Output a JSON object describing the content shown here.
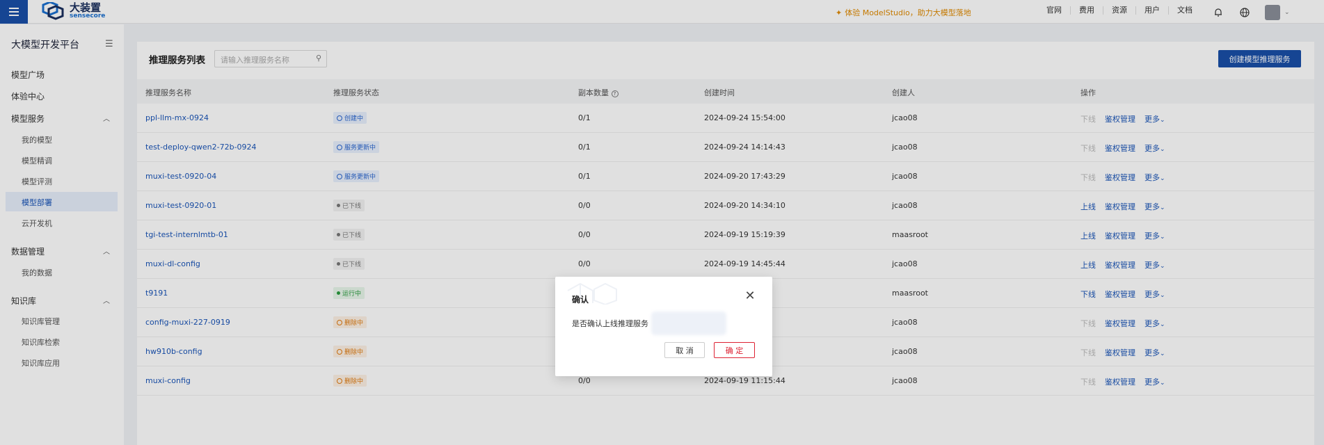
{
  "topbar": {
    "logo_cn": "大装置",
    "logo_en": "sensecore",
    "promo": "体验 ModelStudio，助力大模型落地",
    "links": [
      "官网",
      "费用",
      "资源",
      "用户",
      "文档"
    ]
  },
  "sidebar": {
    "title": "大模型开发平台",
    "items": {
      "model_square": "模型广场",
      "experience": "体验中心",
      "model_service": "模型服务",
      "my_models": "我的模型",
      "finetune": "模型精调",
      "evaluate": "模型评测",
      "deploy": "模型部署",
      "dev_machine": "云开发机",
      "data_mgmt": "数据管理",
      "my_data": "我的数据",
      "knowledge": "知识库",
      "kb_mgmt": "知识库管理",
      "kb_search": "知识库检索",
      "kb_app": "知识库应用"
    }
  },
  "main": {
    "list_title": "推理服务列表",
    "search_placeholder": "请输入推理服务名称",
    "create_button": "创建模型推理服务",
    "columns": [
      "推理服务名称",
      "推理服务状态",
      "副本数量",
      "创建时间",
      "创建人",
      "操作"
    ],
    "action_labels": {
      "offline": "下线",
      "online": "上线",
      "auth": "鉴权管理",
      "more": "更多"
    },
    "rows": [
      {
        "name": "ppl-llm-mx-0924",
        "status": "创建中",
        "status_color": "blue",
        "replicas": "0/1",
        "created": "2024-09-24 15:54:00",
        "creator": "jcao08",
        "toggle": "下线",
        "toggle_enabled": false
      },
      {
        "name": "test-deploy-qwen2-72b-0924",
        "status": "服务更新中",
        "status_color": "blue",
        "replicas": "0/1",
        "created": "2024-09-24 14:14:43",
        "creator": "jcao08",
        "toggle": "下线",
        "toggle_enabled": false
      },
      {
        "name": "muxi-test-0920-04",
        "status": "服务更新中",
        "status_color": "blue",
        "replicas": "0/1",
        "created": "2024-09-20 17:43:29",
        "creator": "jcao08",
        "toggle": "下线",
        "toggle_enabled": false
      },
      {
        "name": "muxi-test-0920-01",
        "status": "已下线",
        "status_color": "gray",
        "replicas": "0/0",
        "created": "2024-09-20 14:34:10",
        "creator": "jcao08",
        "toggle": "上线",
        "toggle_enabled": true
      },
      {
        "name": "tgi-test-internlmtb-01",
        "status": "已下线",
        "status_color": "gray",
        "replicas": "0/0",
        "created": "2024-09-19 15:19:39",
        "creator": "maasroot",
        "toggle": "上线",
        "toggle_enabled": true
      },
      {
        "name": "muxi-dl-config",
        "status": "已下线",
        "status_color": "gray",
        "replicas": "0/0",
        "created": "2024-09-19 14:45:44",
        "creator": "jcao08",
        "toggle": "上线",
        "toggle_enabled": true
      },
      {
        "name": "t9191",
        "status": "运行中",
        "status_color": "green",
        "replicas": "",
        "created": "",
        "creator": "maasroot",
        "toggle": "下线",
        "toggle_enabled": true
      },
      {
        "name": "config-muxi-227-0919",
        "status": "删除中",
        "status_color": "orange",
        "replicas": "",
        "created": "",
        "creator": "jcao08",
        "toggle": "下线",
        "toggle_enabled": false
      },
      {
        "name": "hw910b-config",
        "status": "删除中",
        "status_color": "orange",
        "replicas": "",
        "created": "",
        "creator": "jcao08",
        "toggle": "下线",
        "toggle_enabled": false
      },
      {
        "name": "muxi-config",
        "status": "删除中",
        "status_color": "orange",
        "replicas": "0/0",
        "created": "2024-09-19 11:15:44",
        "creator": "jcao08",
        "toggle": "下线",
        "toggle_enabled": false
      }
    ]
  },
  "modal": {
    "title": "确认",
    "message": "是否确认上线推理服务",
    "cancel": "取 消",
    "confirm": "确 定"
  },
  "colors": {
    "primary": "#1a4fa8",
    "link": "#1a55b8",
    "danger": "#d22233",
    "promo": "#e08a00"
  }
}
